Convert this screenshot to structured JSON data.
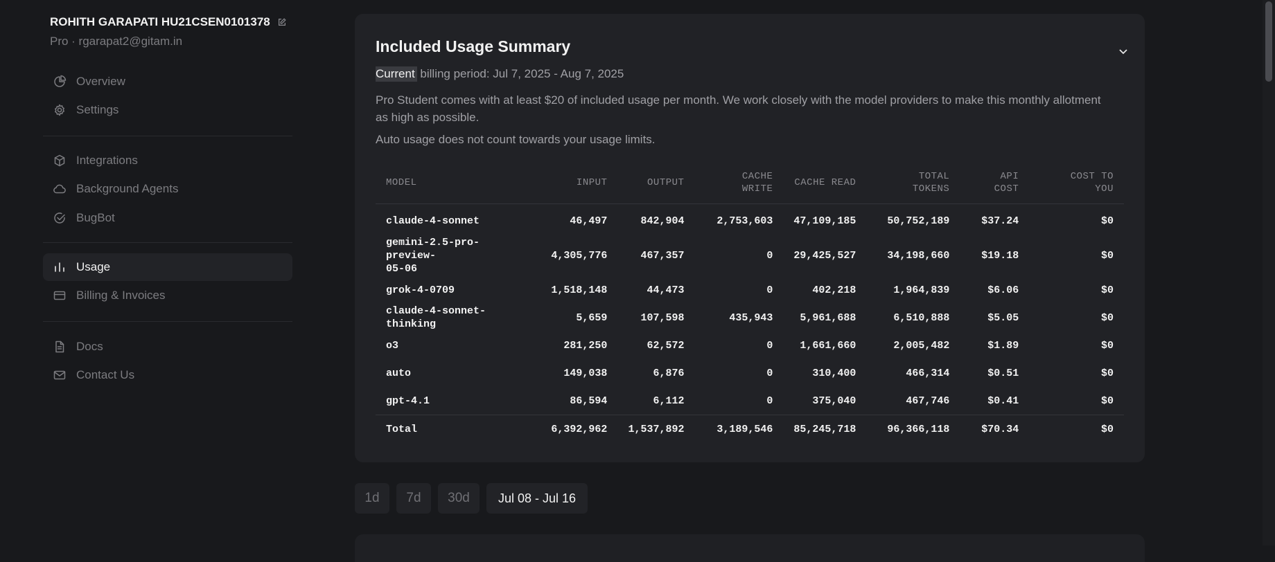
{
  "user": {
    "name": "ROHITH GARAPATI HU21CSEN0101378",
    "subtitle": "Pro · rgarapat2@gitam.in"
  },
  "sidebar": {
    "groups": [
      [
        {
          "label": "Overview",
          "icon": "pie-chart-icon"
        },
        {
          "label": "Settings",
          "icon": "gear-icon"
        }
      ],
      [
        {
          "label": "Integrations",
          "icon": "cube-icon"
        },
        {
          "label": "Background Agents",
          "icon": "cloud-icon"
        },
        {
          "label": "BugBot",
          "icon": "check-circle-icon"
        }
      ],
      [
        {
          "label": "Usage",
          "icon": "bar-chart-icon",
          "active": true
        },
        {
          "label": "Billing & Invoices",
          "icon": "credit-card-icon"
        }
      ],
      [
        {
          "label": "Docs",
          "icon": "document-icon"
        },
        {
          "label": "Contact Us",
          "icon": "mail-icon"
        }
      ]
    ]
  },
  "summary": {
    "title": "Included Usage Summary",
    "billing_highlight": "Current",
    "billing_rest": " billing period: Jul 7, 2025 - Aug 7, 2025",
    "description": "Pro Student comes with at least $20 of included usage per month. We work closely with the model providers to make this monthly allotment as high as possible.",
    "auto_note": "Auto usage does not count towards your usage limits."
  },
  "table": {
    "headers": [
      [
        "MODEL"
      ],
      [
        "INPUT"
      ],
      [
        "OUTPUT"
      ],
      [
        "CACHE",
        "WRITE"
      ],
      [
        "CACHE READ"
      ],
      [
        "TOTAL",
        "TOKENS"
      ],
      [
        "API",
        "COST"
      ],
      [
        "COST TO",
        "YOU"
      ]
    ],
    "rows": [
      [
        [
          "claude-4-sonnet"
        ],
        "46,497",
        "842,904",
        "2,753,603",
        "47,109,185",
        "50,752,189",
        "$37.24",
        "$0"
      ],
      [
        [
          "gemini-2.5-pro-preview-",
          "05-06"
        ],
        "4,305,776",
        "467,357",
        "0",
        "29,425,527",
        "34,198,660",
        "$19.18",
        "$0"
      ],
      [
        [
          "grok-4-0709"
        ],
        "1,518,148",
        "44,473",
        "0",
        "402,218",
        "1,964,839",
        "$6.06",
        "$0"
      ],
      [
        [
          "claude-4-sonnet-thinking"
        ],
        "5,659",
        "107,598",
        "435,943",
        "5,961,688",
        "6,510,888",
        "$5.05",
        "$0"
      ],
      [
        [
          "o3"
        ],
        "281,250",
        "62,572",
        "0",
        "1,661,660",
        "2,005,482",
        "$1.89",
        "$0"
      ],
      [
        [
          "auto"
        ],
        "149,038",
        "6,876",
        "0",
        "310,400",
        "466,314",
        "$0.51",
        "$0"
      ],
      [
        [
          "gpt-4.1"
        ],
        "86,594",
        "6,112",
        "0",
        "375,040",
        "467,746",
        "$0.41",
        "$0"
      ]
    ],
    "total": [
      [
        "Total"
      ],
      "6,392,962",
      "1,537,892",
      "3,189,546",
      "85,245,718",
      "96,366,118",
      "$70.34",
      "$0"
    ]
  },
  "range_buttons": [
    {
      "label": "1d"
    },
    {
      "label": "7d"
    },
    {
      "label": "30d"
    },
    {
      "label": "Jul 08 - Jul 16",
      "active": true
    }
  ],
  "colors": {
    "background": "#18191c",
    "card": "#212226",
    "text_primary": "#f2f2f2",
    "text_muted": "#7c7c80",
    "active_nav": "#222327"
  }
}
